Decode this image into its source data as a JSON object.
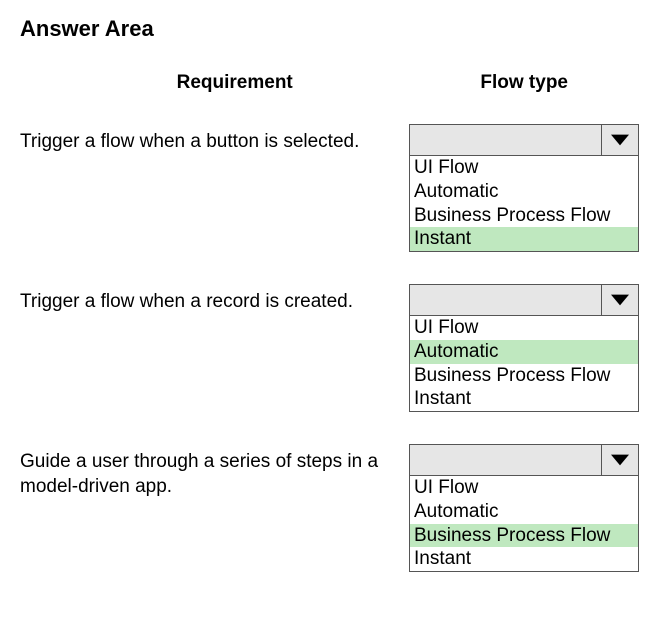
{
  "title": "Answer Area",
  "columns": {
    "requirement": "Requirement",
    "flowtype": "Flow type"
  },
  "rows": [
    {
      "requirement": "Trigger a flow when a button is selected.",
      "selected": "",
      "options": [
        {
          "label": "UI Flow",
          "highlight": false
        },
        {
          "label": "Automatic",
          "highlight": false
        },
        {
          "label": "Business Process Flow",
          "highlight": false
        },
        {
          "label": "Instant",
          "highlight": true
        }
      ]
    },
    {
      "requirement": "Trigger a flow when a record is created.",
      "selected": "",
      "options": [
        {
          "label": "UI Flow",
          "highlight": false
        },
        {
          "label": "Automatic",
          "highlight": true
        },
        {
          "label": "Business Process Flow",
          "highlight": false
        },
        {
          "label": "Instant",
          "highlight": false
        }
      ]
    },
    {
      "requirement": "Guide a user through a series of steps in a model-driven app.",
      "selected": "",
      "options": [
        {
          "label": "UI Flow",
          "highlight": false
        },
        {
          "label": "Automatic",
          "highlight": false
        },
        {
          "label": "Business Process Flow",
          "highlight": true
        },
        {
          "label": "Instant",
          "highlight": false
        }
      ]
    }
  ]
}
